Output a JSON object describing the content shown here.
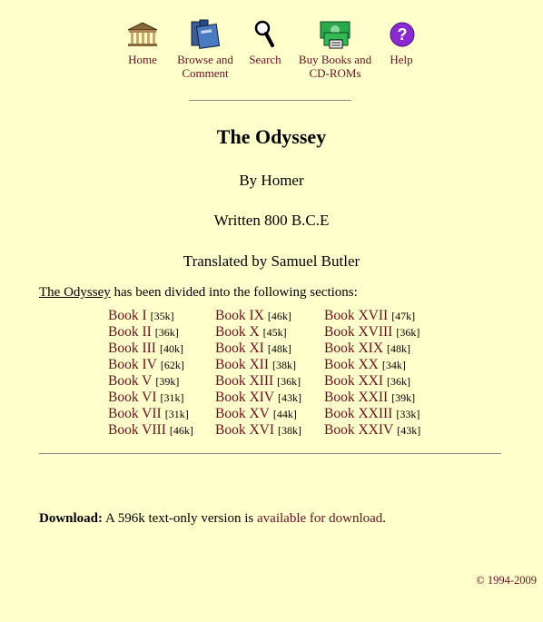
{
  "nav": {
    "items": [
      {
        "label": "Home",
        "label2": "",
        "icon": "temple-icon"
      },
      {
        "label": "Browse and",
        "label2": "Comment",
        "icon": "books-icon"
      },
      {
        "label": "Search",
        "label2": "",
        "icon": "magnifier-icon"
      },
      {
        "label": "Buy Books and",
        "label2": "CD-ROMs",
        "icon": "money-icon"
      },
      {
        "label": "Help",
        "label2": "",
        "icon": "help-icon"
      }
    ]
  },
  "title": "The Odyssey",
  "author": "By Homer",
  "written": "Written 800 B.C.E",
  "translated": "Translated by Samuel Butler",
  "intro": {
    "work": "The Odyssey",
    "text": " has been divided into the following sections:"
  },
  "books": [
    {
      "name": "Book I",
      "size": "[35k]"
    },
    {
      "name": "Book II",
      "size": "[36k]"
    },
    {
      "name": "Book III",
      "size": "[40k]"
    },
    {
      "name": "Book IV",
      "size": "[62k]"
    },
    {
      "name": "Book V",
      "size": "[39k]"
    },
    {
      "name": "Book VI",
      "size": "[31k]"
    },
    {
      "name": "Book VII",
      "size": "[31k]"
    },
    {
      "name": "Book VIII",
      "size": "[46k]"
    },
    {
      "name": "Book IX",
      "size": "[46k]"
    },
    {
      "name": "Book X",
      "size": "[45k]"
    },
    {
      "name": "Book XI",
      "size": "[48k]"
    },
    {
      "name": "Book XII",
      "size": "[38k]"
    },
    {
      "name": "Book XIII",
      "size": "[36k]"
    },
    {
      "name": "Book XIV",
      "size": "[43k]"
    },
    {
      "name": "Book XV",
      "size": "[44k]"
    },
    {
      "name": "Book XVI",
      "size": "[38k]"
    },
    {
      "name": "Book XVII",
      "size": "[47k]"
    },
    {
      "name": "Book XVIII",
      "size": "[36k]"
    },
    {
      "name": "Book XIX",
      "size": "[48k]"
    },
    {
      "name": "Book XX",
      "size": "[34k]"
    },
    {
      "name": "Book XXI",
      "size": "[36k]"
    },
    {
      "name": "Book XXII",
      "size": "[39k]"
    },
    {
      "name": "Book XXIII",
      "size": "[33k]"
    },
    {
      "name": "Book XXIV",
      "size": "[43k]"
    }
  ],
  "download": {
    "label": "Download:",
    "text": " A 596k text-only version is ",
    "link": "available for download",
    "end": "."
  },
  "copyright": "© 1994-2009",
  "colors": {
    "background": "#ffffcc",
    "link": "#6a0f20"
  }
}
